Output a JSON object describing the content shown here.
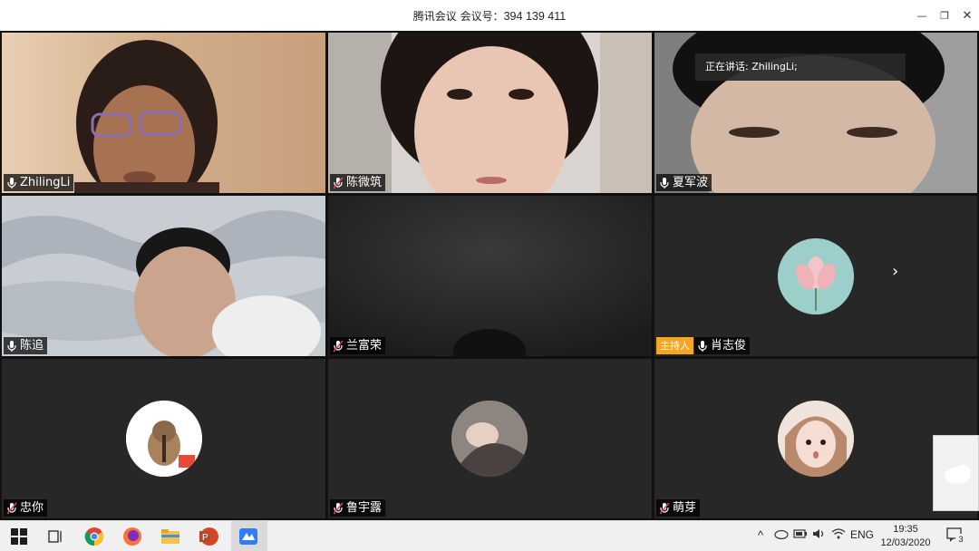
{
  "window": {
    "title_prefix": "腾讯会议 会议号：",
    "meeting_id": "394 139 411",
    "controls": {
      "minimize": "—",
      "restore": "❐",
      "close": "✕"
    }
  },
  "speaking_banner": "正在讲话: ZhilingLi;",
  "host_badge": "主持人",
  "participants": [
    {
      "name": "ZhilingLi",
      "mic": "on"
    },
    {
      "name": "陈微筑",
      "mic": "muted"
    },
    {
      "name": "夏军波",
      "mic": "on"
    },
    {
      "name": "陈追",
      "mic": "on"
    },
    {
      "name": "兰富荣",
      "mic": "muted"
    },
    {
      "name": "肖志俊",
      "mic": "on",
      "host": true
    },
    {
      "name": "忠你",
      "mic": "muted"
    },
    {
      "name": "鲁宇露",
      "mic": "muted"
    },
    {
      "name": "萌芽",
      "mic": "muted"
    }
  ],
  "taskbar": {
    "apps": [
      "windows-start",
      "task-view",
      "chrome",
      "firefox",
      "file-explorer",
      "powerpoint",
      "tencent-meeting"
    ],
    "tray_lang": "ENG",
    "time": "19:35",
    "date": "12/03/2020",
    "notification_count": "3"
  }
}
